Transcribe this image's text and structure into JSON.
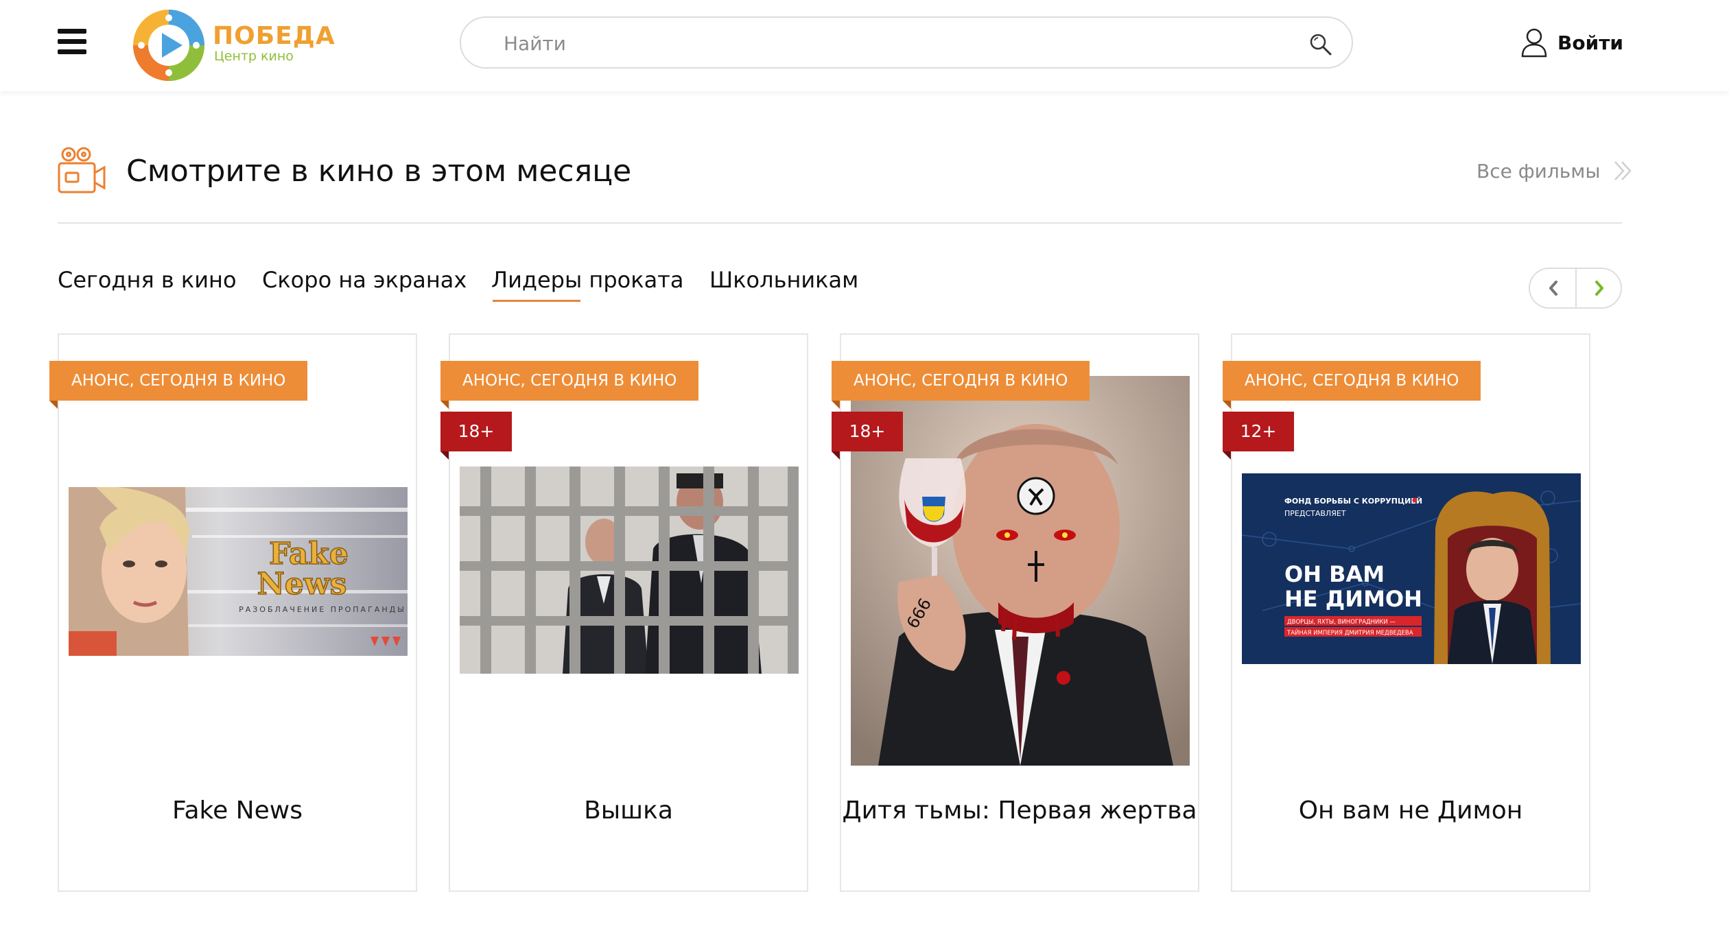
{
  "header": {
    "logo": {
      "name": "ПОБЕДА",
      "subtitle": "Центр кино"
    },
    "search": {
      "placeholder": "Найти",
      "value": ""
    },
    "login_label": "Войти"
  },
  "section": {
    "title": "Смотрите в кино в этом месяце",
    "all_films_label": "Все фильмы"
  },
  "tabs": [
    {
      "label": "Сегодня в кино",
      "active": false
    },
    {
      "label": "Скоро на экранах",
      "active": false
    },
    {
      "label": "Лидеры проката",
      "active": true
    },
    {
      "label": "Школьникам",
      "active": false
    }
  ],
  "colors": {
    "accent_orange": "#ee8d37",
    "age_badge_red": "#b5191c",
    "logo_green": "#8fbf3a",
    "arrow_green": "#7ab829"
  },
  "movies": [
    {
      "title": "Fake News",
      "tag": "АНОНС, СЕГОДНЯ В КИНО",
      "age": "",
      "poster_text": [
        "Fake",
        "News",
        "РАЗОБЛАЧЕНИЕ ПРОПАГАНДЫ"
      ]
    },
    {
      "title": "Вышка",
      "tag": "АНОНС, СЕГОДНЯ В КИНО",
      "age": "18+",
      "poster_text": []
    },
    {
      "title": "Дитя тьмы: Первая жертва",
      "tag": "АНОНС, СЕГОДНЯ В КИНО",
      "age": "18+",
      "poster_text": [
        "666"
      ]
    },
    {
      "title": "Он вам не Димон",
      "tag": "АНОНС, СЕГОДНЯ В КИНО",
      "age": "12+",
      "poster_text": [
        "ФОНД БОРЬБЫ С КОРРУПЦИЕЙ",
        "ПРЕДСТАВЛЯЕТ",
        "ОН ВАМ",
        "НЕ ДИМОН",
        "ДВОРЦЫ, ЯХТЫ, ВИНОГРАДНИКИ —",
        "ТАЙНАЯ ИМПЕРИЯ ДМИТРИЯ МЕДВЕДЕВА"
      ]
    }
  ]
}
